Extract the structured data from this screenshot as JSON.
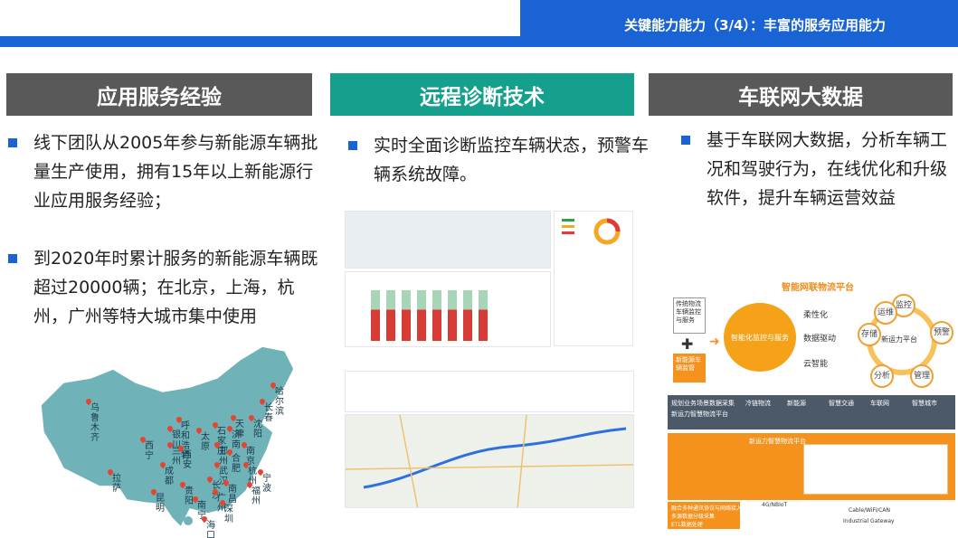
{
  "header": {
    "title": "关键能力能力（3/4）：丰富的服务应用能力"
  },
  "columns": [
    {
      "heading": "应用服务经验"
    },
    {
      "heading": "远程诊断技术"
    },
    {
      "heading": "车联网大数据"
    }
  ],
  "bullets": {
    "b1": "线下团队从2005年参与新能源车辆批量生产使用，拥有15年以上新能源行业应用服务经验；",
    "b2": "到2020年时累计服务的新能源车辆既超过20000辆；在北京，上海，杭州，广州等特大城市集中使用",
    "b3": "实时全面诊断监控车辆状态，预警车辆系统故障。",
    "b4": "基于车联网大数据，分析车辆工况和驾驶行为，在线优化和升级软件，提升车辆运营效益"
  },
  "map": {
    "cities": [
      "哈尔滨",
      "长春",
      "沈阳",
      "乌鲁木齐",
      "呼和浩特",
      "银川",
      "兰州",
      "西宁",
      "成都",
      "拉萨",
      "昆明",
      "太原",
      "石家庄",
      "郑州",
      "西安",
      "济南",
      "南京",
      "合肥",
      "杭州",
      "宁波",
      "武汉",
      "长沙",
      "南昌",
      "福州",
      "贵阳",
      "南宁",
      "广州",
      "深圳",
      "海口",
      "天津"
    ]
  },
  "diagram_a": {
    "title": "智能网联物流平台",
    "left_top": "传统物流车辆监控与服务",
    "left_bottom": "新能源车辆监管",
    "center": "智能化监控与服务",
    "labels": [
      "柔性化",
      "数据驱动",
      "云智能"
    ],
    "ring_center": "新运力平台",
    "ring_nodes": [
      "监控",
      "预警",
      "管理",
      "分析",
      "存储",
      "运维"
    ]
  },
  "diagram_b": {
    "top_tabs": [
      "冷链物流",
      "新能源",
      "智慧交通",
      "车联网",
      "智慧城市"
    ],
    "left_items": [
      "规划业务场景数据采集",
      "新运力智慧物流平台"
    ],
    "platform_title": "新运力智慧物流平台",
    "bottom_left": [
      "融合多种通讯协议与网络接入方式",
      "多源数据分级采集",
      "ETL数据处理"
    ],
    "bottom_labels": [
      "4G/NBIoT",
      "Industrial Gateway",
      "Cable/WiFi/CAN"
    ]
  }
}
